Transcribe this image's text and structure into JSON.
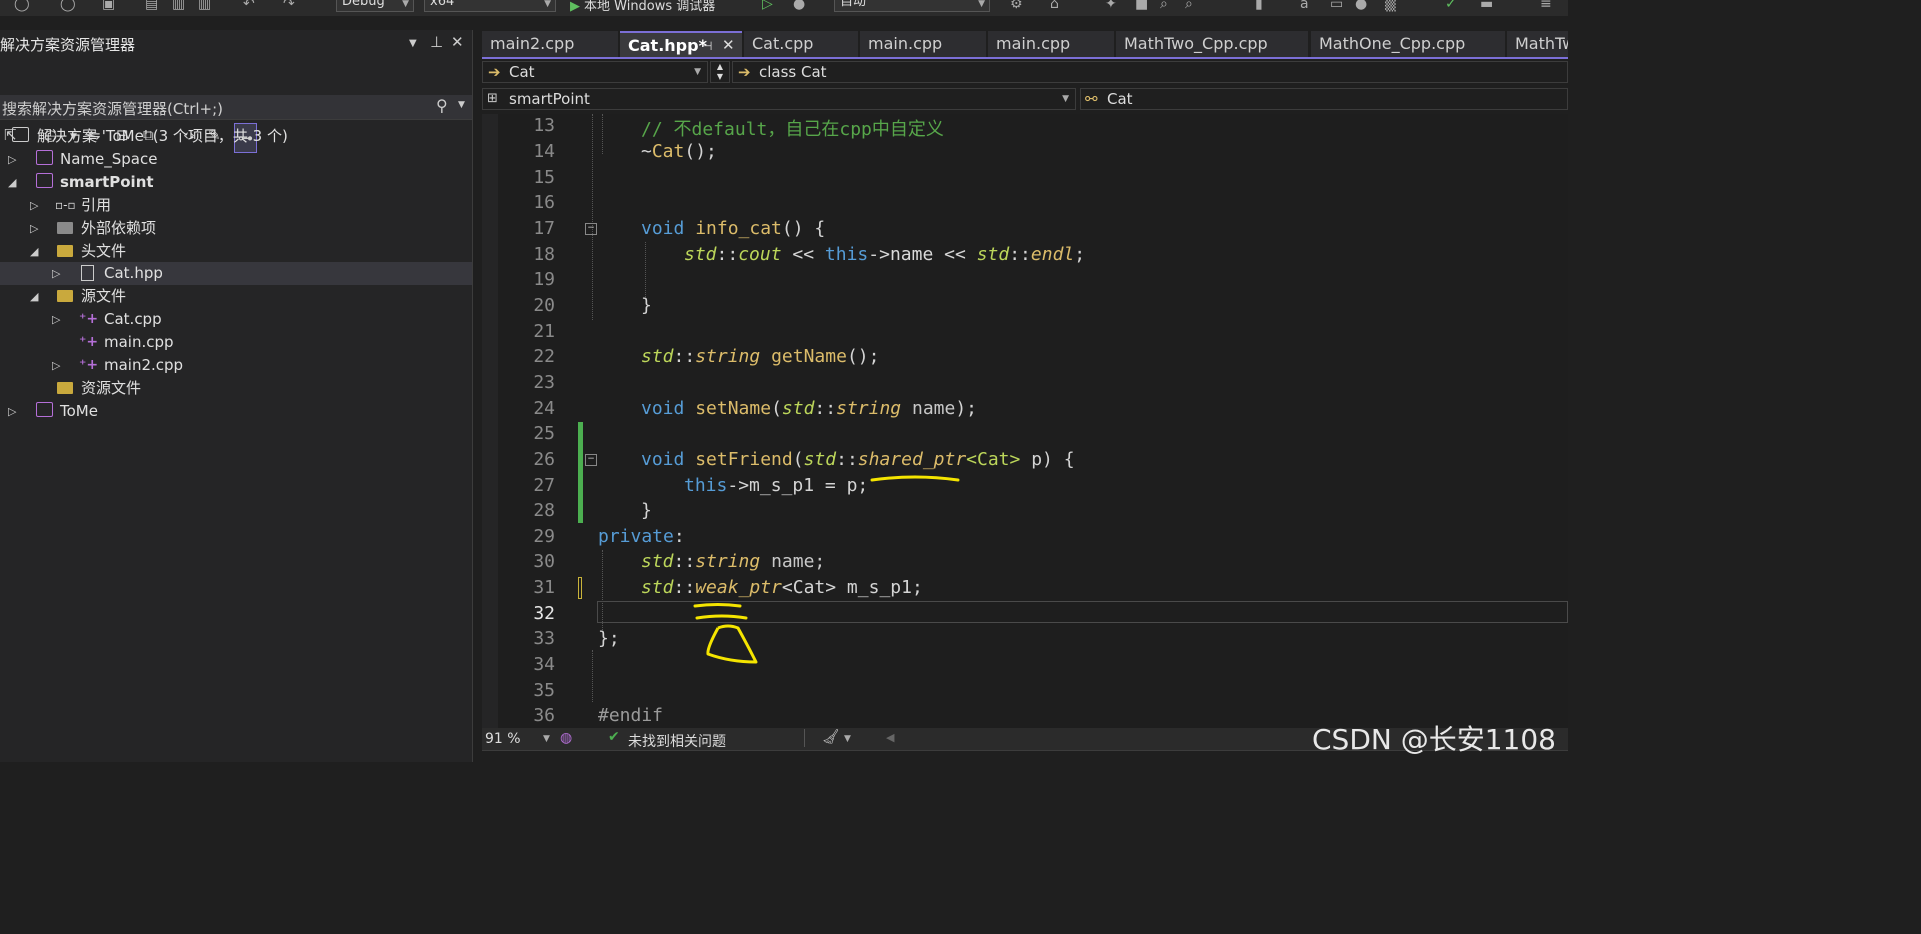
{
  "toolbar": {
    "config": "Debug",
    "platform": "x64",
    "run_label": "本地 Windows 调试器",
    "solution_config": "自动"
  },
  "solution_explorer": {
    "title": "解决方案资源管理器",
    "search_placeholder": "搜索解决方案资源管理器(Ctrl+;)",
    "tree": [
      {
        "label": "解决方案 'ToMe' (3 个项目，共 3 个)"
      },
      {
        "label": "Name_Space"
      },
      {
        "label": "smartPoint"
      },
      {
        "label": "引用"
      },
      {
        "label": "外部依赖项"
      },
      {
        "label": "头文件"
      },
      {
        "label": "Cat.hpp"
      },
      {
        "label": "源文件"
      },
      {
        "label": "Cat.cpp"
      },
      {
        "label": "main.cpp"
      },
      {
        "label": "main2.cpp"
      },
      {
        "label": "资源文件"
      },
      {
        "label": "ToMe"
      }
    ]
  },
  "tabs": [
    {
      "label": "main2.cpp"
    },
    {
      "label": "Cat.hpp*"
    },
    {
      "label": "Cat.cpp"
    },
    {
      "label": "main.cpp"
    },
    {
      "label": "main.cpp"
    },
    {
      "label": "MathTwo_Cpp.cpp"
    },
    {
      "label": "MathOne_Cpp.cpp"
    },
    {
      "label": "MathTw"
    }
  ],
  "nav": {
    "scope": "Cat",
    "class": "class Cat",
    "project": "smartPoint",
    "member": "Cat"
  },
  "editor": {
    "line_numbers": [
      "13",
      "14",
      "15",
      "16",
      "17",
      "18",
      "19",
      "20",
      "21",
      "22",
      "23",
      "24",
      "25",
      "26",
      "27",
      "28",
      "29",
      "30",
      "31",
      "32",
      "33",
      "34",
      "35",
      "36"
    ],
    "current_line": "32",
    "code": {
      "l13_comment": "// 不default，自己在cpp中自定义",
      "l14_tilde": "~",
      "l14_name": "Cat",
      "l14_rest": "();",
      "l17_void": "void",
      "l17_name": "info_cat",
      "l17_rest": "() {",
      "l18_std1": "std",
      "l18_sep1": "::",
      "l18_cout": "cout",
      "l18_op1": " << ",
      "l18_this": "this",
      "l18_arrow": "->",
      "l18_name": "name",
      "l18_op2": " << ",
      "l18_std2": "std",
      "l18_sep2": "::",
      "l18_endl": "endl",
      "l18_semi": ";",
      "l20_brace": "}",
      "l22_std": "std",
      "l22_sep": "::",
      "l22_string": "string",
      "l22_fn": "getName",
      "l22_rest": "();",
      "l24_void": "void",
      "l24_fn": "setName",
      "l24_open": "(",
      "l24_std": "std",
      "l24_sep": "::",
      "l24_string": "string",
      "l24_param": " name",
      "l24_close": ");",
      "l26_void": "void",
      "l26_fn": "setFriend",
      "l26_open": "(",
      "l26_std": "std",
      "l26_sep": "::",
      "l26_shared": "shared_ptr",
      "l26_tmpl": "<Cat>",
      "l26_param": " p) {",
      "l27_this": "this",
      "l27_rest": "->m_s_p1 = p;",
      "l28_brace": "}",
      "l29_private": "private",
      "l29_colon": ":",
      "l30_std": "std",
      "l30_sep": "::",
      "l30_string": "string",
      "l30_rest": " name;",
      "l31_std": "std",
      "l31_sep": "::",
      "l31_weak": "weak_ptr",
      "l31_rest": "<Cat> m_s_p1;",
      "l33_close": "};",
      "l36_pp": "#endif"
    }
  },
  "statusbar": {
    "zoom": "91 %",
    "issues": "未找到相关问题"
  },
  "watermark": "CSDN @长安1108",
  "colors": {
    "accent": "#7b6fd6",
    "change_bar_saved": "#4caf50",
    "change_bar_unsaved": "#c9b33a",
    "annotation": "#f5e500"
  }
}
